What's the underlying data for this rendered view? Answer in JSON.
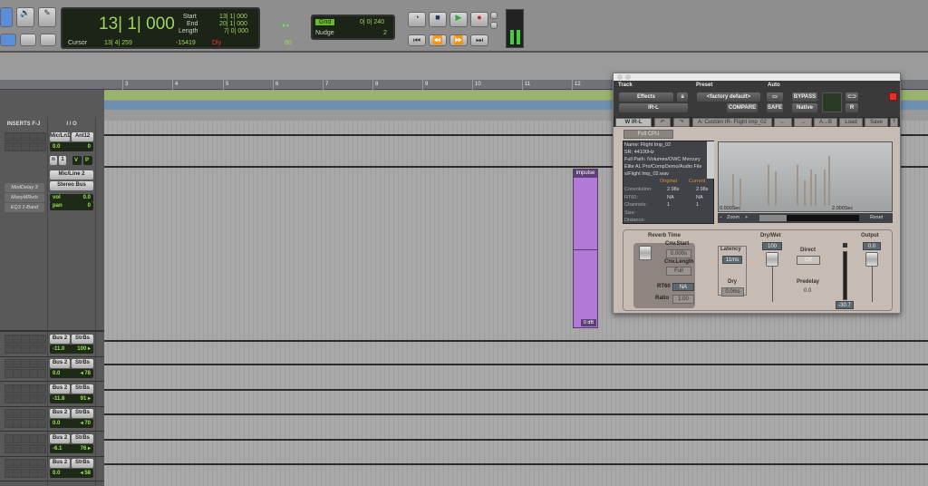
{
  "toolbar": {
    "main_counter": "13| 1| 000",
    "start_label": "Start",
    "end_label": "End",
    "length_label": "Length",
    "start": "13| 1| 000",
    "end": "20| 1| 000",
    "length": "7| 0| 000",
    "cursor_label": "Cursor",
    "cursor": "13| 4| 259",
    "cursor_value": "-15419",
    "dly": "Dly",
    "tempo": "80",
    "grid_label": "Grid",
    "grid_value": "0| 0| 240",
    "nudge_label": "Nudge",
    "nudge_value": "2"
  },
  "ruler": {
    "bars": [
      "3",
      "4",
      "5",
      "6",
      "7",
      "8",
      "9",
      "10",
      "11",
      "12"
    ]
  },
  "mixer": {
    "inserts_header": "INSERTS F-J",
    "io_header": "I / O",
    "track1": {
      "input": "Mic/Ln1",
      "output": "Anl12",
      "vol": "0.0",
      "pan": "0",
      "n": "n",
      "num": "1",
      "v": "V",
      "p": "P"
    },
    "track2": {
      "input": "Mic/Line 2",
      "output": "Stereo Bus",
      "inserts": [
        "ModDelay 3",
        "ManyMRvrb",
        "EQ3 1-Band"
      ],
      "vol_label": "vol",
      "vol": "0.0",
      "pan_label": "pan",
      "pan": "0"
    },
    "bus_tracks": [
      {
        "input": "Bus 2",
        "output": "StrBs",
        "vol": "-11.0",
        "pan": "100 ▸"
      },
      {
        "input": "Bus 2",
        "output": "StrBs",
        "vol": "0.0",
        "pan": "◂ 78"
      },
      {
        "input": "Bus 2",
        "output": "StrBs",
        "vol": "-11.8",
        "pan": "91 ▸"
      },
      {
        "input": "Bus 2",
        "output": "StrBs",
        "vol": "0.0",
        "pan": "◂ 70"
      },
      {
        "input": "Bus 2",
        "output": "StrBs",
        "vol": "-6.1",
        "pan": "76 ▸"
      },
      {
        "input": "Bus 2",
        "output": "StrBs",
        "vol": "0.0",
        "pan": "◂ 58"
      }
    ]
  },
  "clip": {
    "name": "impulse",
    "gain": "0 dB",
    "color": "#b07ad6"
  },
  "plugin": {
    "track_label": "Track",
    "preset_label": "Preset",
    "auto_label": "Auto",
    "track_type": "Effects",
    "track_name": "IR-L",
    "channel": "a",
    "preset": "<factory default>",
    "compare": "COMPARE",
    "safe": "SAFE",
    "bypass": "BYPASS",
    "native": "Native",
    "side": "R",
    "logo": "W IR-L",
    "preset_name": "A: Custom IR- Flight Imp_02",
    "ab": "A→B",
    "load": "Load",
    "save": "Save",
    "help": "?",
    "full_cpu": "Full CPU",
    "file_info": [
      "Name: Flight Imp_02",
      "SR: 44100Hz",
      "Full Path: /Volumes/OWC Mercury",
      "Elite AL Pro/CompDemo/Audio File",
      "s/Flight Imp_02.wav"
    ],
    "col_original": "Original",
    "col_current": "Current",
    "rows": [
      {
        "label": "Convolution:",
        "original": "2.98s",
        "current": "2.98s"
      },
      {
        "label": "RT60:",
        "original": "NA",
        "current": "NA"
      },
      {
        "label": "Channels:",
        "original": "1",
        "current": "1"
      },
      {
        "label": "Size:",
        "original": "",
        "current": ""
      },
      {
        "label": "Distance:",
        "original": "",
        "current": ""
      }
    ],
    "time_start": "0.000Sec",
    "time_end": "2.000Sec",
    "zoom": "Zoom",
    "reset": "Reset",
    "reverb_time": "Reverb Time",
    "cnv_start_label": "Cnv.Start",
    "cnv_start": "0.000s",
    "cnv_length_label": "Cnv.Length",
    "cnv_length": "Full",
    "rt60_label": "RT60",
    "rt60": "NA",
    "ratio_label": "Ratio",
    "ratio": "1.00",
    "latency_label": "Latency",
    "latency": "11ms",
    "dry_label": "Dry",
    "dry": "0.0ms",
    "drywet_label": "Dry/Wet",
    "drywet": "100",
    "direct_label": "Direct",
    "direct": "Off",
    "predelay_label": "Predelay",
    "predelay": "0.0",
    "output_label": "Output",
    "output": "0.0",
    "meter": "-30.7"
  }
}
